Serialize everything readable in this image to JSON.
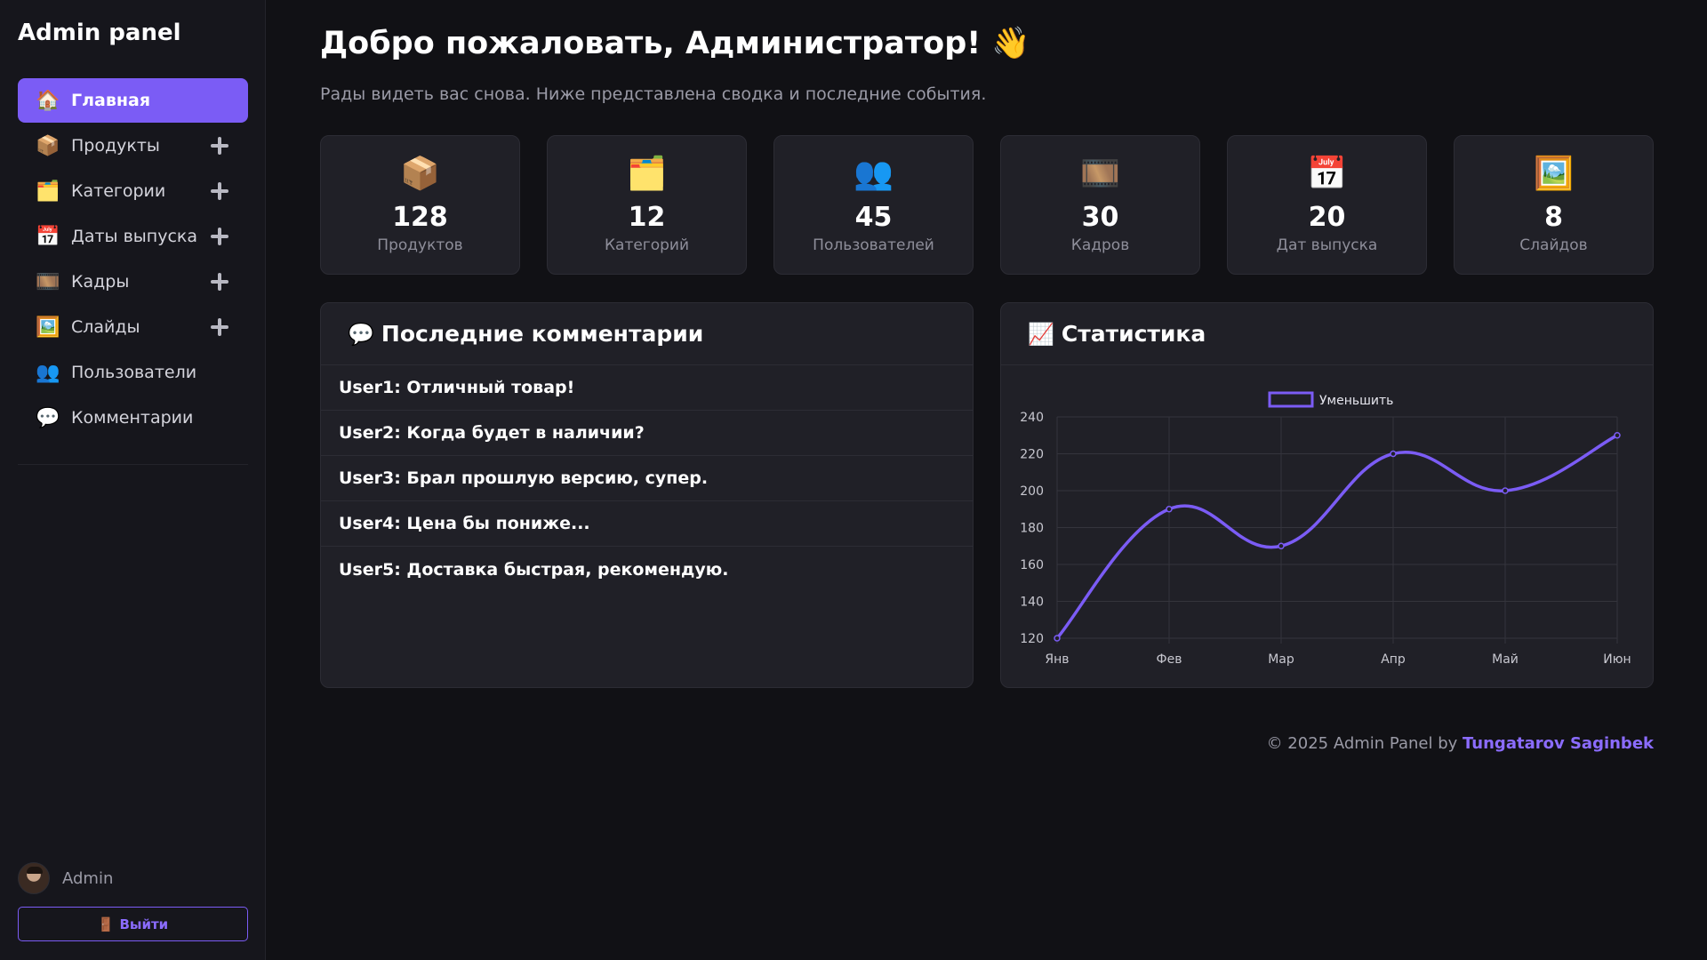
{
  "sidebar": {
    "brand": "Admin panel",
    "items": [
      {
        "icon": "🏠",
        "icon_name": "home-icon",
        "label": "Главная"
      },
      {
        "icon": "📦",
        "icon_name": "package-icon",
        "label": "Продукты"
      },
      {
        "icon": "🗂️",
        "icon_name": "folder-icon",
        "label": "Категории"
      },
      {
        "icon": "📅",
        "icon_name": "calendar-icon",
        "label": "Даты выпуска"
      },
      {
        "icon": "🎞️",
        "icon_name": "film-frames-icon",
        "label": "Кадры"
      },
      {
        "icon": "🖼️",
        "icon_name": "picture-icon",
        "label": "Слайды"
      },
      {
        "icon": "👥",
        "icon_name": "users-icon",
        "label": "Пользователи"
      },
      {
        "icon": "💬",
        "icon_name": "speech-bubble-icon",
        "label": "Комментарии"
      }
    ],
    "user": {
      "name": "Admin"
    },
    "logout": {
      "icon": "🚪",
      "label": "Выйти"
    }
  },
  "header": {
    "title": "Добро пожаловать, Администратор! 👋",
    "subtitle": "Рады видеть вас снова. Ниже представлена сводка и последние события."
  },
  "stats": [
    {
      "icon": "📦",
      "icon_name": "package-icon",
      "value": "128",
      "label": "Продуктов"
    },
    {
      "icon": "🗂️",
      "icon_name": "folder-icon",
      "value": "12",
      "label": "Категорий"
    },
    {
      "icon": "👥",
      "icon_name": "users-icon",
      "value": "45",
      "label": "Пользователей"
    },
    {
      "icon": "🎞️",
      "icon_name": "film-frames-icon",
      "value": "30",
      "label": "Кадров"
    },
    {
      "icon": "📅",
      "icon_name": "calendar-icon",
      "value": "20",
      "label": "Дат выпуска"
    },
    {
      "icon": "🖼️",
      "icon_name": "picture-icon",
      "value": "8",
      "label": "Слайдов"
    }
  ],
  "comments": {
    "icon": "💬",
    "title": "Последние комментарии",
    "items": [
      "User1: Отличный товар!",
      "User2: Когда будет в наличии?",
      "User3: Брал прошлую версию, супер.",
      "User4: Цена бы пониже...",
      "User5: Доставка быстрая, рекомендую."
    ]
  },
  "stats_panel": {
    "icon": "📈",
    "title": "Статистика"
  },
  "chart_data": {
    "type": "line",
    "categories": [
      "Янв",
      "Фев",
      "Мар",
      "Апр",
      "Май",
      "Июн"
    ],
    "series": [
      {
        "name": "Уменьшить",
        "values": [
          120,
          190,
          170,
          220,
          200,
          230
        ]
      }
    ],
    "ylim": [
      120,
      240
    ],
    "yticks": [
      120,
      140,
      160,
      180,
      200,
      220,
      240
    ],
    "grid": true,
    "legend": "top",
    "smooth": true,
    "color": "#7b5cf5"
  },
  "footer": {
    "text": "© 2025 Admin Panel by ",
    "author": "Tungatarov Saginbek"
  },
  "colors": {
    "accent": "#7b5cf5",
    "background": "#111115",
    "sidebar": "#16161c",
    "card": "#202027"
  }
}
